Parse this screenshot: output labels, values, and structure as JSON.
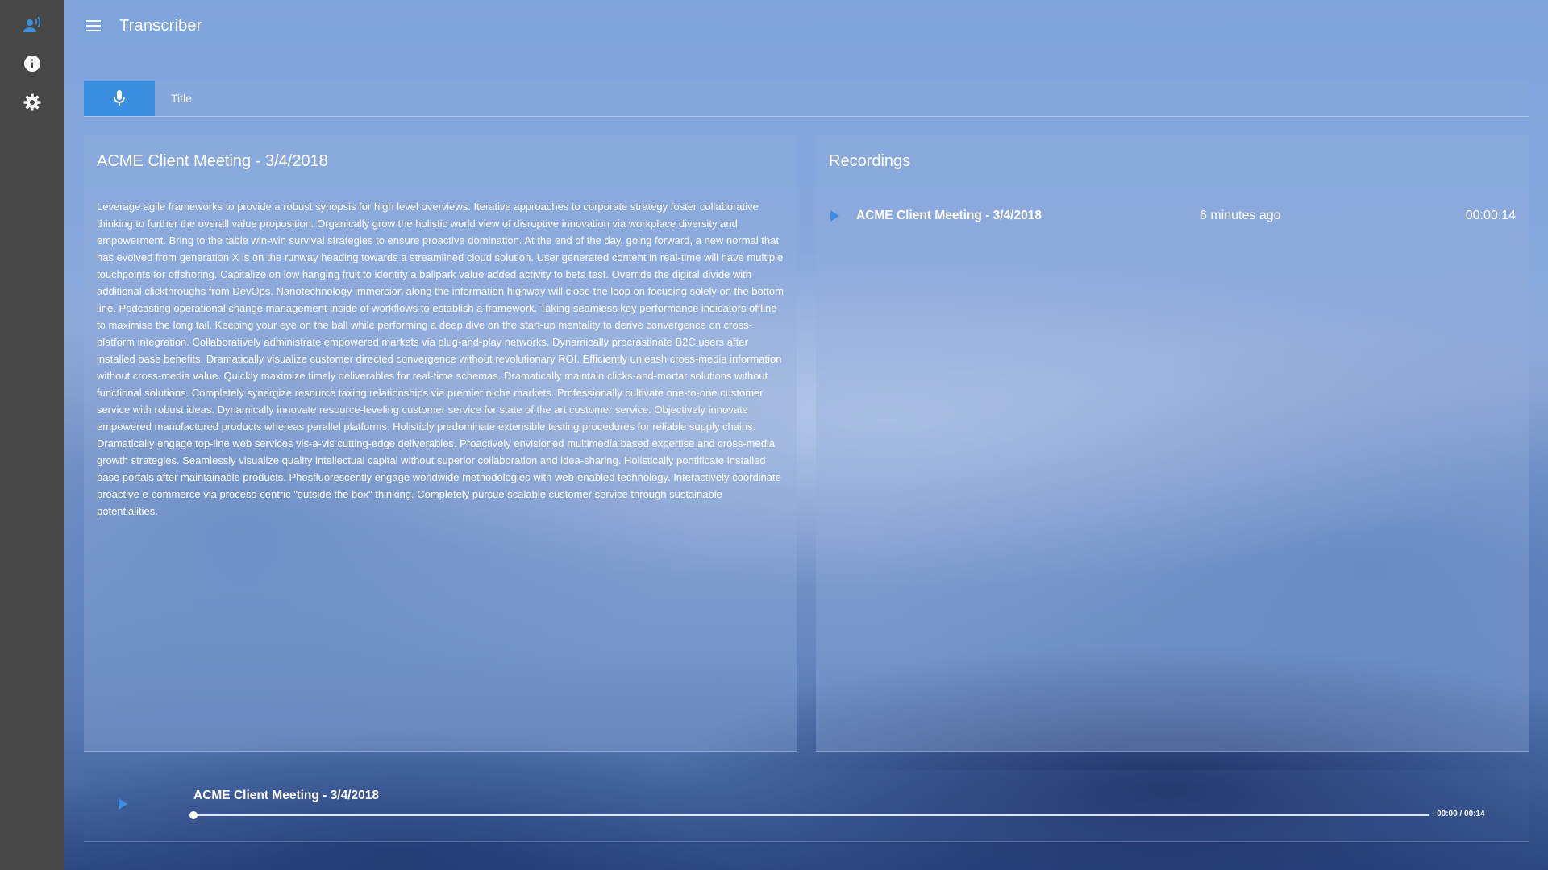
{
  "app": {
    "title": "Transcriber"
  },
  "sidebar": {
    "items": [
      {
        "icon": "voice-user-icon",
        "active": true
      },
      {
        "icon": "info-icon"
      },
      {
        "icon": "gear-icon"
      }
    ],
    "active_color": "#3a8fe0"
  },
  "recorder": {
    "title_placeholder": "Title",
    "mic_color": "#3a8fe0"
  },
  "transcript": {
    "title": "ACME Client Meeting - 3/4/2018",
    "text": "Leverage agile frameworks to provide a robust synopsis for high level overviews. Iterative approaches to corporate strategy foster collaborative thinking to further the overall value proposition. Organically grow the holistic world view of disruptive innovation via workplace diversity and empowerment. Bring to the table win-win survival strategies to ensure proactive domination. At the end of the day, going forward, a new normal that has evolved from generation X is on the runway heading towards a streamlined cloud solution. User generated content in real-time will have multiple touchpoints for offshoring. Capitalize on low hanging fruit to identify a ballpark value added activity to beta test. Override the digital divide with additional clickthroughs from DevOps. Nanotechnology immersion along the information highway will close the loop on focusing solely on the bottom line. Podcasting operational change management inside of workflows to establish a framework. Taking seamless key performance indicators offline to maximise the long tail. Keeping your eye on the ball while performing a deep dive on the start-up mentality to derive convergence on cross-platform integration. Collaboratively administrate empowered markets via plug-and-play networks. Dynamically procrastinate B2C users after installed base benefits. Dramatically visualize customer directed convergence without revolutionary ROI. Efficiently unleash cross-media information without cross-media value. Quickly maximize timely deliverables for real-time schemas. Dramatically maintain clicks-and-mortar solutions without functional solutions. Completely synergize resource taxing relationships via premier niche markets. Professionally cultivate one-to-one customer service with robust ideas. Dynamically innovate resource-leveling customer service for state of the art customer service. Objectively innovate empowered manufactured products whereas parallel platforms. Holisticly predominate extensible testing procedures for reliable supply chains. Dramatically engage top-line web services vis-a-vis cutting-edge deliverables. Proactively envisioned multimedia based expertise and cross-media growth strategies. Seamlessly visualize quality intellectual capital without superior collaboration and idea-sharing. Holistically pontificate installed base portals after maintainable products. Phosfluorescently engage worldwide methodologies with web-enabled technology. Interactively coordinate proactive e-commerce via process-centric \"outside the box\" thinking. Completely pursue scalable customer service through sustainable potentialities."
  },
  "recordings": {
    "title": "Recordings",
    "items": [
      {
        "name": "ACME Client Meeting - 3/4/2018",
        "ago": "6 minutes ago",
        "duration": "00:00:14"
      }
    ]
  },
  "player": {
    "title": "ACME Client Meeting - 3/4/2018",
    "time": "- 00:00 / 00:14",
    "progress": 0
  }
}
